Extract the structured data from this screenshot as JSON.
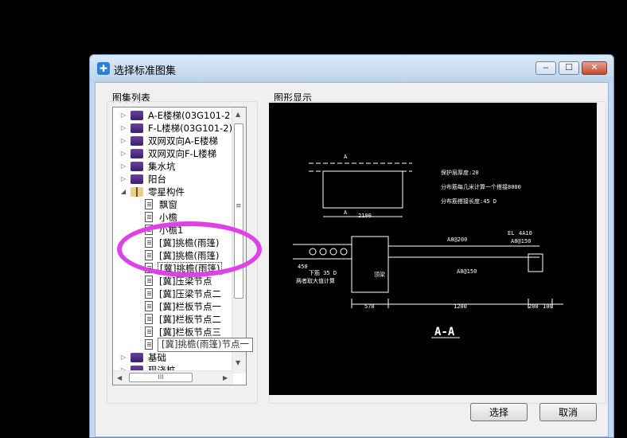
{
  "dialog": {
    "title": "选择标准图集",
    "minimize": "‒",
    "maximize": "☐",
    "close": "✕"
  },
  "list_panel": {
    "label": "图集列表"
  },
  "preview_panel": {
    "label": "图形显示"
  },
  "tree": [
    {
      "label": "A-E楼梯(03G101-2)",
      "type": "book",
      "level": 0,
      "expander": "▷"
    },
    {
      "label": "F-L楼梯(03G101-2)",
      "type": "book",
      "level": 0,
      "expander": "▷"
    },
    {
      "label": "双网双向A-E楼梯",
      "type": "book",
      "level": 0,
      "expander": "▷"
    },
    {
      "label": "双网双向F-L楼梯",
      "type": "book",
      "level": 0,
      "expander": "▷"
    },
    {
      "label": "集水坑",
      "type": "book",
      "level": 0,
      "expander": "▷"
    },
    {
      "label": "阳台",
      "type": "book",
      "level": 0,
      "expander": "▷"
    },
    {
      "label": "零星构件",
      "type": "book-open",
      "level": 0,
      "expander": "◢"
    },
    {
      "label": "飘窗",
      "type": "doc",
      "level": 1
    },
    {
      "label": "小檐",
      "type": "doc",
      "level": 1
    },
    {
      "label": "小檐1",
      "type": "doc",
      "level": 1
    },
    {
      "label": "[冀]挑檐(雨篷)",
      "type": "doc",
      "level": 1
    },
    {
      "label": "[冀]挑檐(雨篷)",
      "type": "doc",
      "level": 1
    },
    {
      "label": "[冀]挑檐(雨篷)",
      "type": "doc",
      "level": 1,
      "selected": true
    },
    {
      "label": "[冀]压梁节点",
      "type": "doc",
      "level": 1
    },
    {
      "label": "[冀]压梁节点二",
      "type": "doc",
      "level": 1
    },
    {
      "label": "[冀]栏板节点一",
      "type": "doc",
      "level": 1
    },
    {
      "label": "[冀]栏板节点二",
      "type": "doc",
      "level": 1
    },
    {
      "label": "[冀]栏板节点三",
      "type": "doc",
      "level": 1
    },
    {
      "label": "[冀]挑檐",
      "type": "doc",
      "level": 1
    },
    {
      "label": "基础",
      "type": "book",
      "level": 0,
      "expander": "▷"
    },
    {
      "label": "现浇桩",
      "type": "book",
      "level": 0,
      "expander": "▷"
    }
  ],
  "tooltip": "[冀]挑檐(雨篷)节点一",
  "scroll": {
    "up": "▲",
    "down": "▼",
    "left": "◀",
    "right": "▶",
    "grip": "≡",
    "hgrip": "III"
  },
  "drawing": {
    "notes": [
      "保护层厚度:20",
      "分布筋每几米计算一个搭接8000",
      "分布筋搭接长度:45 D"
    ],
    "dims": [
      "2100",
      "570",
      "1200",
      "200",
      "100"
    ],
    "section_labels": [
      "A",
      "A"
    ],
    "rebar_labels": [
      "A8@200",
      "A8@150",
      "A8@150",
      "EL",
      "4A10"
    ],
    "side_labels": [
      "450",
      "下筋 35 D",
      "两者取大值计算"
    ],
    "side_note": "顶梁",
    "caption": "A-A"
  },
  "buttons": {
    "select": "选择",
    "cancel": "取消"
  }
}
